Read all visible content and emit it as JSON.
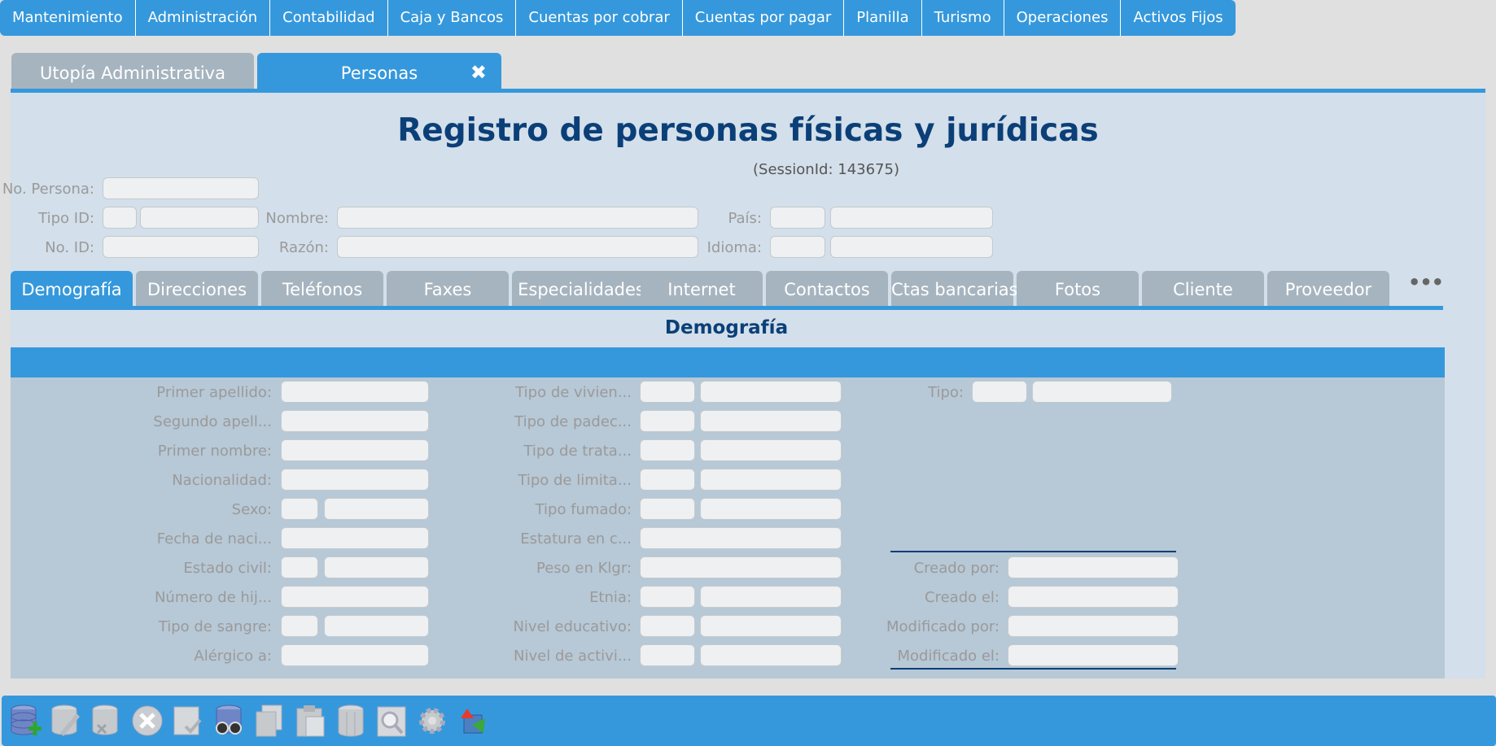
{
  "menu": [
    "Mantenimiento",
    "Administración",
    "Contabilidad",
    "Caja y Bancos",
    "Cuentas por cobrar",
    "Cuentas por pagar",
    "Planilla",
    "Turismo",
    "Operaciones",
    "Activos Fijos"
  ],
  "doc_tabs": {
    "inactive": "Utopía Administrativa",
    "active": "Personas",
    "close_glyph": "✖"
  },
  "header": {
    "title": "Registro de personas físicas y jurídicas",
    "session": "(SessionId: 143675)"
  },
  "fields": {
    "no_persona": "No. Persona:",
    "tipo_id": "Tipo ID:",
    "no_id": "No. ID:",
    "nombre": "Nombre:",
    "razon": "Razón:",
    "pais": "País:",
    "idioma": "Idioma:"
  },
  "form_tabs": [
    "Demografía",
    "Direcciones",
    "Teléfonos",
    "Faxes",
    "Especialidades",
    "Internet",
    "Contactos",
    "Ctas bancarias",
    "Fotos",
    "Cliente",
    "Proveedor"
  ],
  "more_glyph": "•••",
  "section": {
    "title": "Demografía"
  },
  "demografia": {
    "col1": [
      "Primer apellido:",
      "Segundo apell...",
      "Primer nombre:",
      "Nacionalidad:",
      "Sexo:",
      "Fecha de naci...",
      "Estado civil:",
      "Número de hij...",
      "Tipo de sangre:",
      "Alérgico a:"
    ],
    "col2": [
      "Tipo de vivien...",
      "Tipo de padec...",
      "Tipo de trata...",
      "Tipo de limita...",
      "Tipo fumado:",
      "Estatura en c...",
      "Peso en Klgr:",
      "Etnia:",
      "Nivel educativo:",
      "Nivel de activi..."
    ],
    "tipo": "Tipo:",
    "audit": [
      "Creado por:",
      "Creado el:",
      "Modificado por:",
      "Modificado el:"
    ]
  },
  "toolbar": [
    "add-record-icon",
    "edit-record-icon",
    "delete-record-icon",
    "cancel-icon",
    "confirm-icon",
    "search-binoculars-icon",
    "copy-icon",
    "paste-icon",
    "columns-icon",
    "zoom-icon",
    "settings-icon",
    "refresh-icon"
  ],
  "colors": {
    "accent": "#3598dc",
    "title": "#0b3f78",
    "inactive_tab": "#a6b4bf",
    "panel": "#d3dfea",
    "form_area": "#b7c8d6"
  }
}
